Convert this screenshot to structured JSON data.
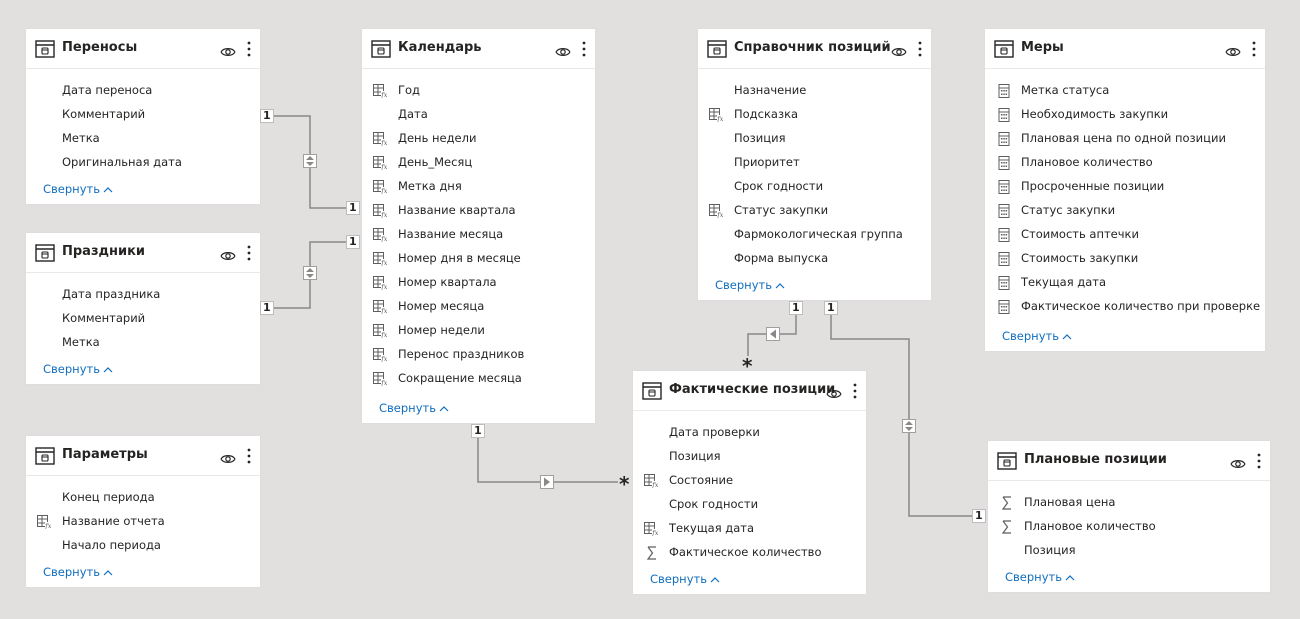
{
  "tables": [
    {
      "id": "perenosy",
      "title": "Переносы",
      "fields": [
        {
          "label": "Дата переноса",
          "icon": "none"
        },
        {
          "label": "Комментарий",
          "icon": "none"
        },
        {
          "label": "Метка",
          "icon": "none"
        },
        {
          "label": "Оригинальная дата",
          "icon": "none"
        }
      ],
      "collapse_label": "Свернуть"
    },
    {
      "id": "prazdniki",
      "title": "Праздники",
      "fields": [
        {
          "label": "Дата праздника",
          "icon": "none"
        },
        {
          "label": "Комментарий",
          "icon": "none"
        },
        {
          "label": "Метка",
          "icon": "none"
        }
      ],
      "collapse_label": "Свернуть"
    },
    {
      "id": "parametry",
      "title": "Параметры",
      "fields": [
        {
          "label": "Конец периода",
          "icon": "none"
        },
        {
          "label": "Название отчета",
          "icon": "calc-column-icon"
        },
        {
          "label": "Начало периода",
          "icon": "none"
        }
      ],
      "collapse_label": "Свернуть"
    },
    {
      "id": "kalendar",
      "title": "Календарь",
      "fields": [
        {
          "label": "Год",
          "icon": "calc-column-icon"
        },
        {
          "label": "Дата",
          "icon": "none"
        },
        {
          "label": "День недели",
          "icon": "calc-column-icon"
        },
        {
          "label": "День_Месяц",
          "icon": "calc-column-icon"
        },
        {
          "label": "Метка дня",
          "icon": "calc-column-icon"
        },
        {
          "label": "Название квартала",
          "icon": "calc-column-icon"
        },
        {
          "label": "Название месяца",
          "icon": "calc-column-icon"
        },
        {
          "label": "Номер дня в месяце",
          "icon": "calc-column-icon"
        },
        {
          "label": "Номер квартала",
          "icon": "calc-column-icon"
        },
        {
          "label": "Номер месяца",
          "icon": "calc-column-icon"
        },
        {
          "label": "Номер недели",
          "icon": "calc-column-icon"
        },
        {
          "label": "Перенос праздников",
          "icon": "calc-column-icon"
        },
        {
          "label": "Сокращение месяца",
          "icon": "calc-column-icon"
        }
      ],
      "collapse_label": "Свернуть"
    },
    {
      "id": "spravochnik",
      "title": "Справочник позиций",
      "fields": [
        {
          "label": "Назначение",
          "icon": "none"
        },
        {
          "label": "Подсказка",
          "icon": "calc-column-icon"
        },
        {
          "label": "Позиция",
          "icon": "none"
        },
        {
          "label": "Приоритет",
          "icon": "none"
        },
        {
          "label": "Срок годности",
          "icon": "none"
        },
        {
          "label": "Статус закупки",
          "icon": "calc-column-icon"
        },
        {
          "label": "Фармокологическая группа",
          "icon": "none"
        },
        {
          "label": "Форма выпуска",
          "icon": "none"
        }
      ],
      "collapse_label": "Свернуть"
    },
    {
      "id": "mery",
      "title": "Меры",
      "fields": [
        {
          "label": "Метка статуса",
          "icon": "measure-icon"
        },
        {
          "label": "Необходимость закупки",
          "icon": "measure-icon"
        },
        {
          "label": "Плановая цена по одной позиции",
          "icon": "measure-icon"
        },
        {
          "label": "Плановое количество",
          "icon": "measure-icon"
        },
        {
          "label": "Просроченные позиции",
          "icon": "measure-icon"
        },
        {
          "label": "Статус закупки",
          "icon": "measure-icon"
        },
        {
          "label": "Стоимость аптечки",
          "icon": "measure-icon"
        },
        {
          "label": "Стоимость закупки",
          "icon": "measure-icon"
        },
        {
          "label": "Текущая дата",
          "icon": "measure-icon"
        },
        {
          "label": "Фактическое количество при проверке",
          "icon": "measure-icon"
        }
      ],
      "collapse_label": "Свернуть"
    },
    {
      "id": "fakticheskie",
      "title": "Фактические позиции",
      "fields": [
        {
          "label": "Дата проверки",
          "icon": "none"
        },
        {
          "label": "Позиция",
          "icon": "none"
        },
        {
          "label": "Состояние",
          "icon": "calc-column-icon"
        },
        {
          "label": "Срок годности",
          "icon": "none"
        },
        {
          "label": "Текущая дата",
          "icon": "calc-column-icon"
        },
        {
          "label": "Фактическое количество",
          "icon": "sum-icon"
        }
      ],
      "collapse_label": "Свернуть"
    },
    {
      "id": "planovye",
      "title": "Плановые позиции",
      "fields": [
        {
          "label": "Плановая цена",
          "icon": "sum-icon"
        },
        {
          "label": "Плановое количество",
          "icon": "sum-icon"
        },
        {
          "label": "Позиция",
          "icon": "none"
        }
      ],
      "collapse_label": "Свернуть"
    }
  ],
  "relationships": [
    {
      "from": "perenosy",
      "to": "kalendar",
      "from_card": "1",
      "to_card": "1",
      "direction": "both"
    },
    {
      "from": "prazdniki",
      "to": "kalendar",
      "from_card": "1",
      "to_card": "1",
      "direction": "both"
    },
    {
      "from": "kalendar",
      "to": "fakticheskie",
      "from_card": "1",
      "to_card": "*",
      "direction": "single"
    },
    {
      "from": "spravochnik",
      "to": "fakticheskie",
      "from_card": "1",
      "to_card": "*",
      "direction": "single"
    },
    {
      "from": "spravochnik",
      "to": "planovye",
      "from_card": "1",
      "to_card": "1",
      "direction": "both"
    }
  ],
  "colors": {
    "canvas": "#e1e0df",
    "card": "#ffffff",
    "link": "#106ebe",
    "line": "#8a8886",
    "text": "#252423"
  }
}
